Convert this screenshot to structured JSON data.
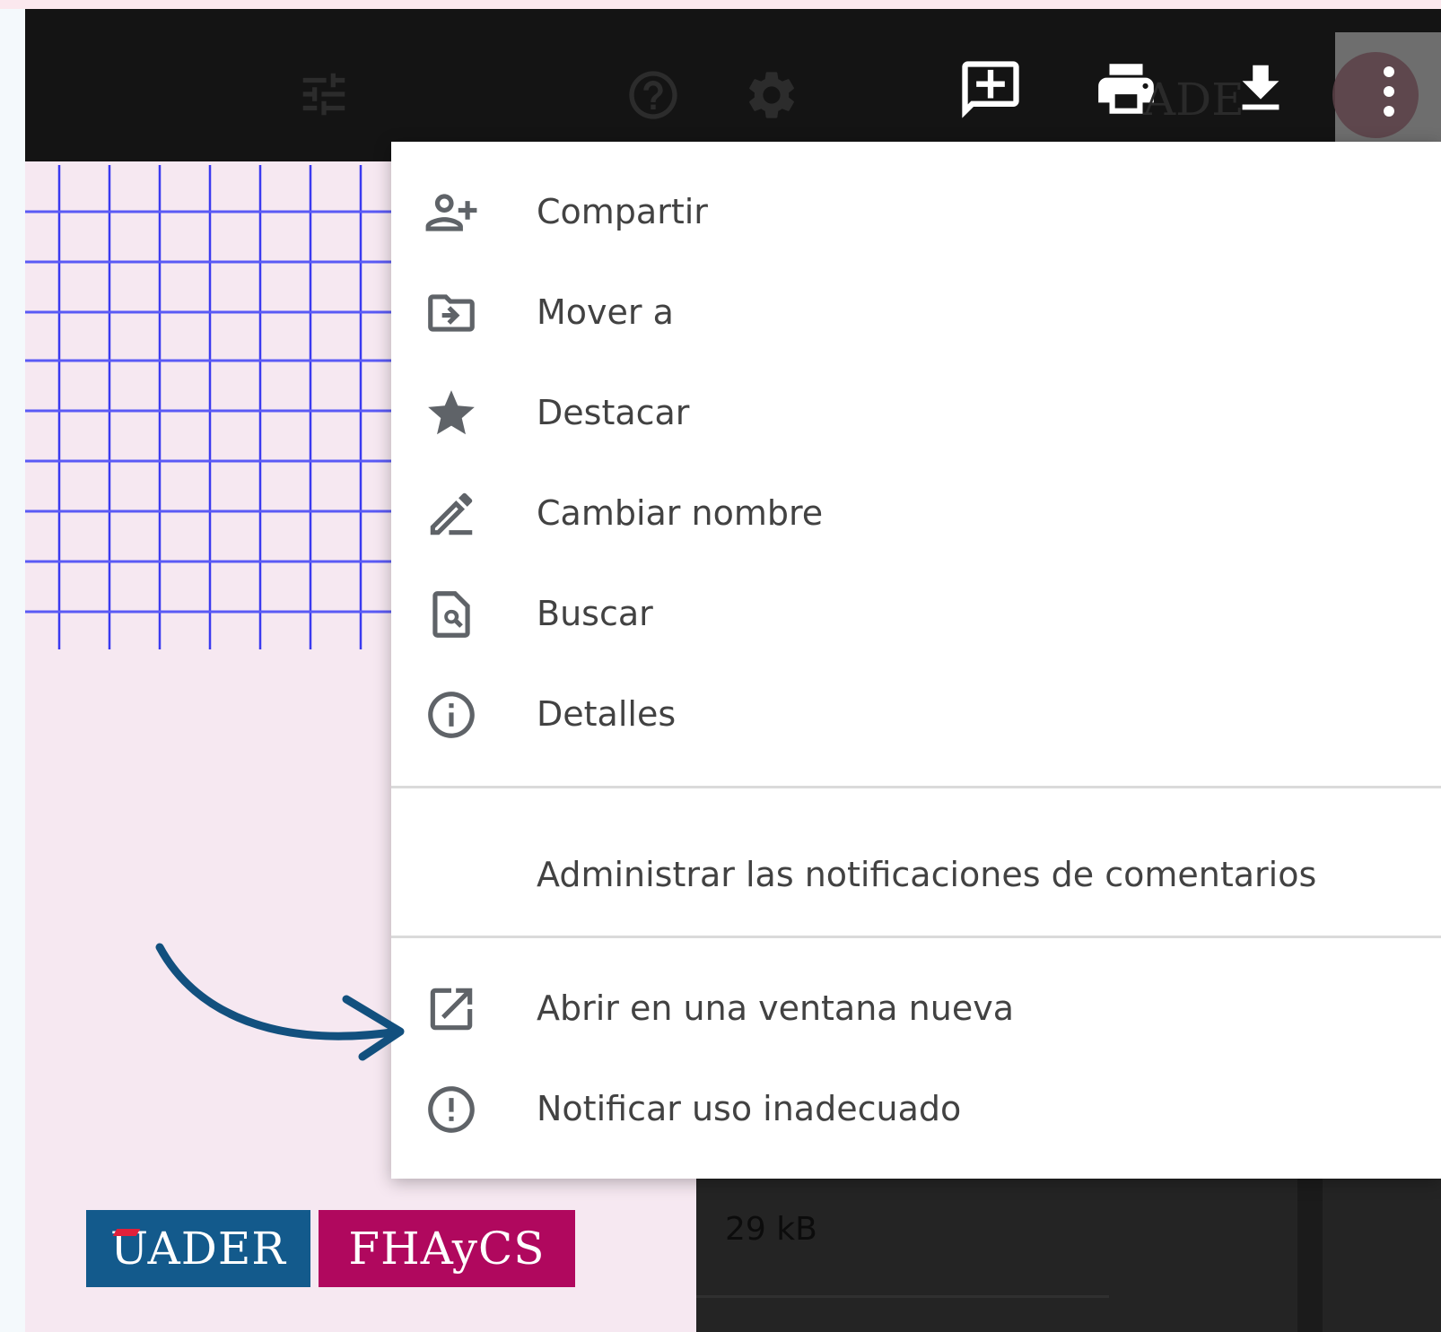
{
  "menu": {
    "items": [
      {
        "label": "Compartir",
        "icon": "person-add-icon"
      },
      {
        "label": "Mover a",
        "icon": "folder-move-icon"
      },
      {
        "label": "Destacar",
        "icon": "star-icon"
      },
      {
        "label": "Cambiar nombre",
        "icon": "pencil-icon"
      },
      {
        "label": "Buscar",
        "icon": "doc-search-icon"
      },
      {
        "label": "Detalles",
        "icon": "info-icon"
      }
    ],
    "notifications_label": "Administrar las notificaciones de comentarios",
    "open_new_window_label": "Abrir en una ventana nueva",
    "report_label": "Notificar uso inadecuado"
  },
  "toolbar": {
    "icons": [
      "tune-icon",
      "help-icon",
      "settings-icon",
      "add-comment-icon",
      "print-icon",
      "download-icon",
      "more-vert-icon"
    ]
  },
  "background": {
    "file_size": "29 kB"
  },
  "logos": {
    "uader": "UADER",
    "fhaycs": "FHAyCS"
  },
  "colors": {
    "toolbar": "#141414",
    "menu_text": "#424242",
    "icon_grey": "#5f6368",
    "arrow": "#12507e",
    "uader_blue": "#135a8c",
    "fhaycs_magenta": "#b0085e",
    "grid_blue": "#3a3af0"
  }
}
